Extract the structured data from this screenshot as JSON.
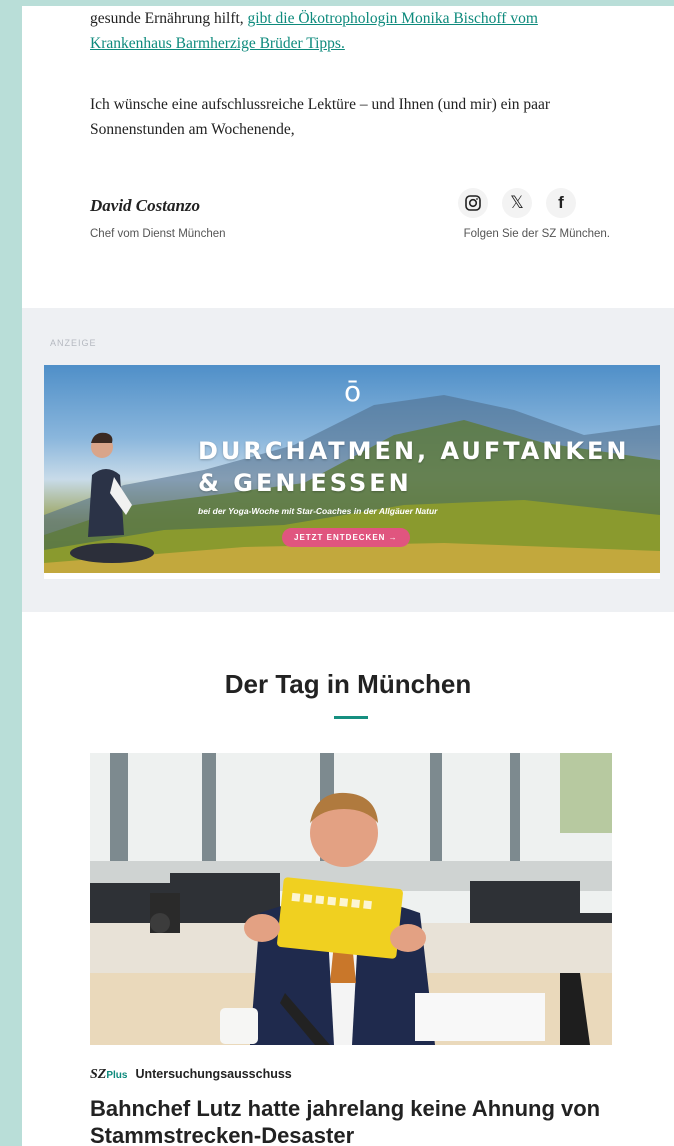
{
  "intro": {
    "text_start": "gesunde Ernährung hilft, ",
    "link_text": "gibt die Ökotrophologin Monika Bischoff vom Krankenhaus Barmherzige Brüder Tipps.",
    "paragraph2": "Ich wünsche eine aufschlussreiche Lektüre – und Ihnen (und mir) ein paar Sonnenstunden am Wochenende,"
  },
  "author": {
    "name": "David Costanzo",
    "role": "Chef vom Dienst München"
  },
  "social": {
    "icons": [
      "instagram-icon",
      "x-icon",
      "facebook-icon"
    ],
    "x_glyph": "𝕏",
    "facebook_glyph": "f",
    "follow_text": "Folgen Sie der SZ München."
  },
  "ad": {
    "label": "ANZEIGE",
    "logo_glyph": "ō",
    "logo_sub": "",
    "headline_1": "DURCHATMEN, AUFTANKEN",
    "headline_2": "& GENIESSEN",
    "subline": "bei der Yoga-Woche mit Star-Coaches in der Allgäuer Natur",
    "cta": "JETZT ENTDECKEN →"
  },
  "section": {
    "title": "Der Tag in München",
    "accent_color": "#168f80"
  },
  "article": {
    "brand": "SZ",
    "brand_plus": "Plus",
    "kicker": "Untersuchungsausschuss",
    "headline": "Bahnchef Lutz hatte jahrelang keine Ahnung von Stammstrecken-Desaster",
    "photo_nameplate": ""
  }
}
